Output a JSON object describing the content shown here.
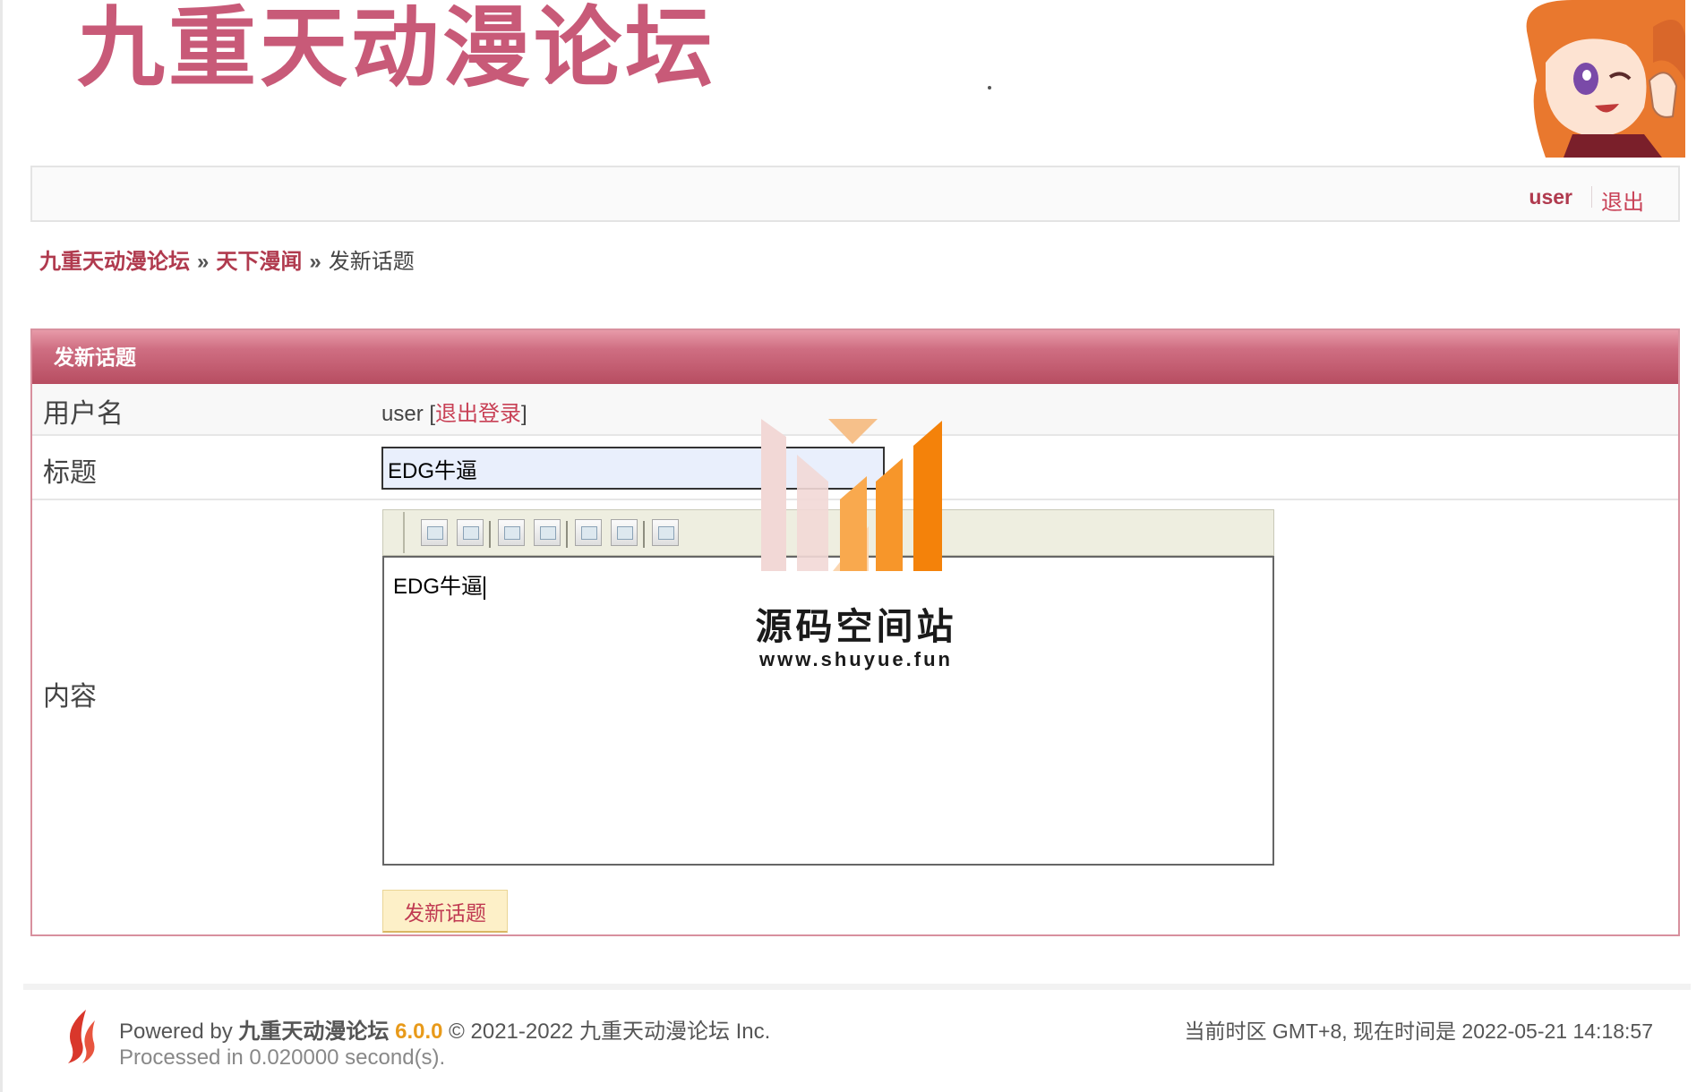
{
  "header": {
    "logo_text": "九重天动漫论坛"
  },
  "userbar": {
    "username": "user",
    "logout": "退出"
  },
  "breadcrumb": {
    "home": "九重天动漫论坛",
    "sep1": "»",
    "forum": "天下漫闻",
    "sep2": "»",
    "current": "发新话题"
  },
  "form": {
    "heading": "发新话题",
    "user_label": "用户名",
    "user_value": "user",
    "user_open_bracket": "[",
    "user_logout_link": "退出登录",
    "user_close_bracket": "]",
    "title_label": "标题",
    "title_value": "EDG牛逼",
    "content_label": "内容",
    "content_value": "EDG牛逼",
    "submit_label": "发新话题"
  },
  "watermark": {
    "title": "源码空间站",
    "url": "www.shuyue.fun"
  },
  "footer": {
    "powered_prefix": "Powered by",
    "brand": "九重天动漫论坛",
    "version": "6.0.0",
    "copyright": "© 2021-2022 九重天动漫论坛 Inc.",
    "processed": "Processed in 0.020000 second(s).",
    "timezone": "当前时区 GMT+8, 现在时间是 2022-05-21 14:18:57"
  },
  "colors": {
    "brand_pink": "#c85a78",
    "link_red": "#c84055",
    "panel_header": "#b74d61",
    "version_orange": "#e89a1a"
  }
}
